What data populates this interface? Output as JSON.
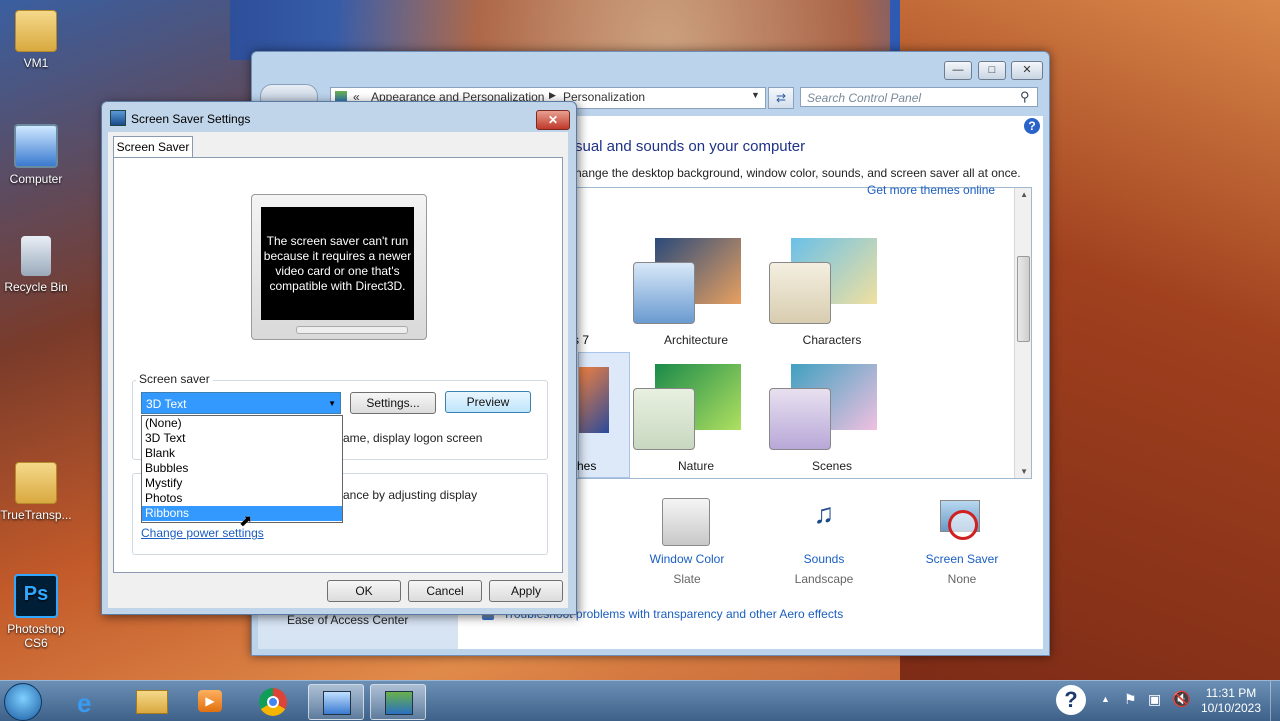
{
  "desktop": {
    "icons": [
      {
        "label": "VM1"
      },
      {
        "label": "Computer"
      },
      {
        "label": "Recycle Bin"
      },
      {
        "label": "TrueTransp..."
      },
      {
        "label": "Photoshop CS6"
      }
    ]
  },
  "control_panel": {
    "breadcrumb": [
      "Appearance and Personalization",
      "Personalization"
    ],
    "breadcrumb_prefix": "«",
    "search_placeholder": "Search Control Panel",
    "title": "sual and sounds on your computer",
    "subtitle": "hange the desktop background, window color, sounds, and screen saver all at once.",
    "get_more_link": "Get more themes online",
    "themes_row1": [
      "s 7",
      "Architecture",
      "Characters"
    ],
    "themes_row2": [
      "hes",
      "Nature",
      "Scenes"
    ],
    "bottom_controls": [
      {
        "label": "ound",
        "sub": ""
      },
      {
        "label": "Window Color",
        "sub": "Slate"
      },
      {
        "label": "Sounds",
        "sub": "Landscape"
      },
      {
        "label": "Screen Saver",
        "sub": "None"
      }
    ],
    "troubleshoot_link": "Troubleshoot problems with transparency and other Aero effects",
    "ease_of_access": "Ease of Access Center"
  },
  "screensaver_dialog": {
    "title": "Screen Saver Settings",
    "tab": "Screen Saver",
    "preview_message": "The screen saver can't run because it requires a newer video card or one that's compatible with Direct3D.",
    "group_label": "Screen saver",
    "selected": "3D Text",
    "settings_button": "Settings...",
    "preview_button": "Preview",
    "resume_text": "ame, display logon screen",
    "power_text": "ance by adjusting display",
    "power_link": "Change power settings",
    "options": [
      "(None)",
      "3D Text",
      "Blank",
      "Bubbles",
      "Mystify",
      "Photos",
      "Ribbons"
    ],
    "highlighted_option": "Ribbons",
    "ok": "OK",
    "cancel": "Cancel",
    "apply": "Apply"
  },
  "taskbar": {
    "time": "11:31 PM",
    "date": "10/10/2023"
  }
}
